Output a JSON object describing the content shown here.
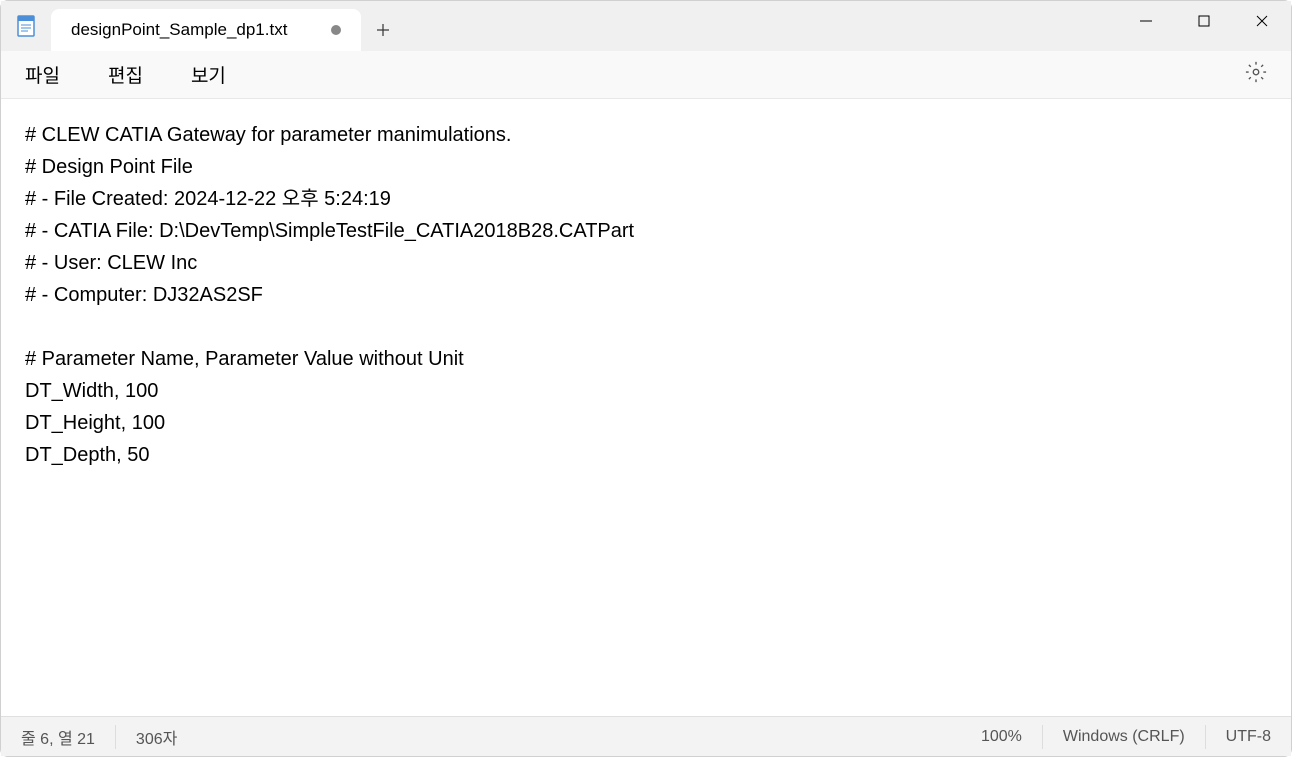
{
  "tab": {
    "title": "designPoint_Sample_dp1.txt",
    "dirty": true
  },
  "menus": {
    "file": "파일",
    "edit": "편집",
    "view": "보기"
  },
  "editor": {
    "content": "# CLEW CATIA Gateway for parameter manimulations.\n# Design Point File\n# - File Created: 2024-12-22 오후 5:24:19\n# - CATIA File: D:\\DevTemp\\SimpleTestFile_CATIA2018B28.CATPart\n# - User: CLEW Inc\n# - Computer: DJ32AS2SF\n\n# Parameter Name, Parameter Value without Unit\nDT_Width, 100\nDT_Height, 100\nDT_Depth, 50"
  },
  "statusbar": {
    "position": "줄 6, 열 21",
    "chars": "306자",
    "zoom": "100%",
    "line_ending": "Windows (CRLF)",
    "encoding": "UTF-8"
  }
}
